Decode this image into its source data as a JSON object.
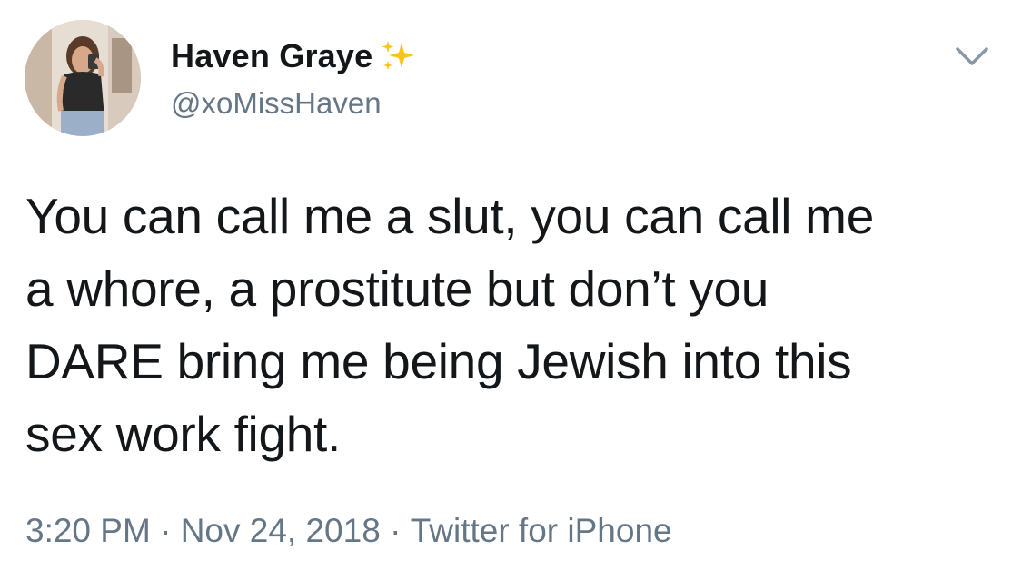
{
  "user": {
    "display_name": "Haven Graye",
    "handle": "@xoMissHaven",
    "badge_icon": "sparkles-icon",
    "avatar": "avatar-photo"
  },
  "tweet": {
    "text": "You can call me a slut, you can call me\na whore, a prostitute but don’t you\nDARE bring me being Jewish into this\nsex work fight.",
    "time": "3:20 PM",
    "date": "Nov 24, 2018",
    "source": "Twitter for iPhone",
    "separator": " · "
  },
  "menu": {
    "icon": "chevron-down-icon"
  },
  "colors": {
    "text": "#14171a",
    "secondary": "#657786",
    "sparkle": "#f5c518"
  }
}
